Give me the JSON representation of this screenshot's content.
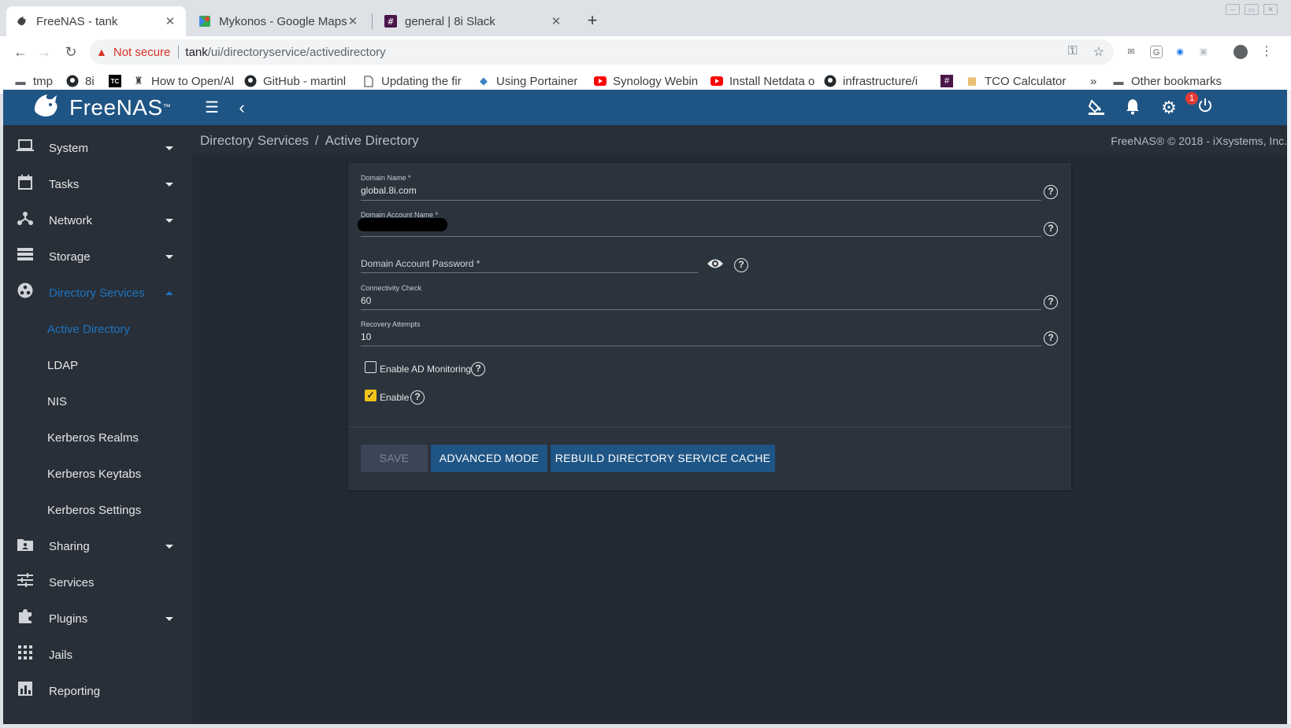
{
  "browser": {
    "tabs": [
      {
        "title": "FreeNAS - tank",
        "icon": "freenas-icon"
      },
      {
        "title": "Mykonos - Google Maps",
        "icon": "google-maps-icon"
      },
      {
        "title": "general | 8i Slack",
        "icon": "slack-icon"
      }
    ],
    "address": {
      "security_label": "Not secure",
      "host": "tank",
      "path": "/ui/directoryservice/activedirectory"
    },
    "bookmarks": [
      {
        "label": "tmp",
        "icon": "folder-icon"
      },
      {
        "label": "8i",
        "icon": "github-icon"
      },
      {
        "label": "",
        "icon": "teamcity-icon"
      },
      {
        "label": "How to Open/Al",
        "icon": "notion-icon"
      },
      {
        "label": "GitHub - martinl",
        "icon": "github-icon"
      },
      {
        "label": "Updating the fir",
        "icon": "page-icon"
      },
      {
        "label": "Using Portainer",
        "icon": "portainer-icon"
      },
      {
        "label": "Synology Webin",
        "icon": "youtube-icon"
      },
      {
        "label": "Install Netdata o",
        "icon": "youtube-icon"
      },
      {
        "label": "infrastructure/i",
        "icon": "github-icon"
      },
      {
        "label": "",
        "icon": "slack-icon"
      },
      {
        "label": "TCO Calculator",
        "icon": "box-icon"
      }
    ],
    "other_bookmarks": "Other bookmarks",
    "overflow": "»"
  },
  "app": {
    "brand": "FreeNAS",
    "notification_count": "1",
    "breadcrumb": [
      "Directory Services",
      "Active Directory"
    ],
    "breadcrumb_separator": "/",
    "copyright": "FreeNAS® © 2018 - iXsystems, Inc."
  },
  "sidebar": {
    "items": [
      {
        "label": "System",
        "icon": "laptop-icon"
      },
      {
        "label": "Tasks",
        "icon": "calendar-icon"
      },
      {
        "label": "Network",
        "icon": "network-icon"
      },
      {
        "label": "Storage",
        "icon": "storage-icon"
      },
      {
        "label": "Directory Services",
        "icon": "directory-services-icon"
      },
      {
        "label": "Sharing",
        "icon": "sharing-icon"
      },
      {
        "label": "Services",
        "icon": "services-icon"
      },
      {
        "label": "Plugins",
        "icon": "puzzle-icon"
      },
      {
        "label": "Jails",
        "icon": "jails-icon"
      },
      {
        "label": "Reporting",
        "icon": "reporting-icon"
      }
    ],
    "directory_sub": [
      "Active Directory",
      "LDAP",
      "NIS",
      "Kerberos Realms",
      "Kerberos Keytabs",
      "Kerberos Settings"
    ]
  },
  "form": {
    "domain_name": {
      "label": "Domain Name *",
      "value": "global.8i.com"
    },
    "domain_account_name": {
      "label": "Domain Account Name *"
    },
    "domain_account_password": {
      "placeholder": "Domain Account Password *"
    },
    "connectivity_check": {
      "label": "Connectivity Check",
      "value": "60"
    },
    "recovery_attempts": {
      "label": "Recovery Attempts",
      "value": "10"
    },
    "enable_ad_monitoring": {
      "label": "Enable AD Monitoring",
      "checked": false
    },
    "enable": {
      "label": "Enable",
      "checked": true
    },
    "buttons": {
      "save": "SAVE",
      "advanced": "ADVANCED MODE",
      "rebuild": "REBUILD DIRECTORY SERVICE CACHE"
    }
  },
  "colors": {
    "topbar": "#1f5585",
    "sidebar": "#282f38",
    "content_bg": "#232a33",
    "card_bg": "#2b333d",
    "accent_active": "#1f74c0",
    "checkbox_checked": "#f0c419"
  }
}
